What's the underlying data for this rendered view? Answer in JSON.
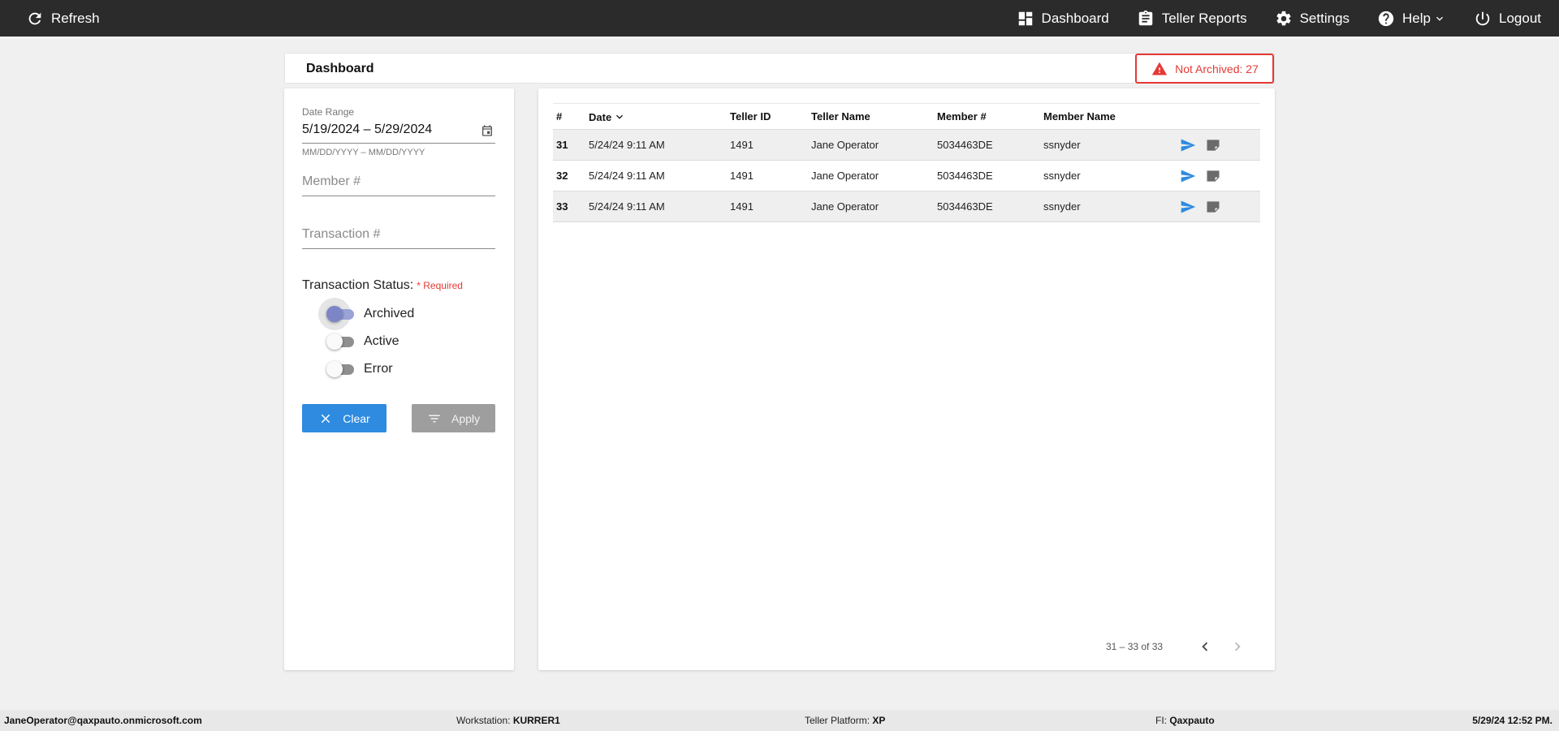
{
  "nav": {
    "refresh": "Refresh",
    "dashboard": "Dashboard",
    "teller_reports": "Teller Reports",
    "settings": "Settings",
    "help": "Help",
    "logout": "Logout"
  },
  "header": {
    "title": "Dashboard",
    "not_archived": "Not Archived: 27"
  },
  "filters": {
    "date_range_label": "Date Range",
    "date_range_value": "5/19/2024 – 5/29/2024",
    "date_hint": "MM/DD/YYYY – MM/DD/YYYY",
    "member_placeholder": "Member #",
    "transaction_placeholder": "Transaction #",
    "status_label": "Transaction Status:",
    "required": "* Required",
    "toggles": [
      {
        "label": "Archived",
        "on": true
      },
      {
        "label": "Active",
        "on": false
      },
      {
        "label": "Error",
        "on": false
      }
    ],
    "clear_label": "Clear",
    "apply_label": "Apply"
  },
  "table": {
    "columns": [
      "#",
      "Date",
      "Teller ID",
      "Teller Name",
      "Member #",
      "Member Name"
    ],
    "rows": [
      {
        "num": "31",
        "date": "5/24/24 9:11 AM",
        "teller_id": "1491",
        "teller_name": "Jane Operator",
        "member_num": "5034463DE",
        "member_name": "ssnyder"
      },
      {
        "num": "32",
        "date": "5/24/24 9:11 AM",
        "teller_id": "1491",
        "teller_name": "Jane Operator",
        "member_num": "5034463DE",
        "member_name": "ssnyder"
      },
      {
        "num": "33",
        "date": "5/24/24 9:11 AM",
        "teller_id": "1491",
        "teller_name": "Jane Operator",
        "member_num": "5034463DE",
        "member_name": "ssnyder"
      }
    ],
    "pager": "31 – 33 of 33"
  },
  "footer": {
    "user": "JaneOperator@qaxpauto.onmicrosoft.com",
    "workstation_label": "Workstation:",
    "workstation": "KURRER1",
    "platform_label": "Teller Platform:",
    "platform": "XP",
    "fi_label": "FI:",
    "fi": "Qaxpauto",
    "datetime": "5/29/24 12:52 PM."
  },
  "colors": {
    "topbar": "#2b2b2b",
    "accent_blue": "#2e8be0",
    "alert_red": "#e53935",
    "toggle_on": "#7c86c6"
  },
  "icons": [
    "refresh-icon",
    "dashboard-icon",
    "clipboard-icon",
    "gear-icon",
    "help-icon",
    "chevron-down-icon",
    "power-icon",
    "warning-icon",
    "calendar-icon",
    "close-icon",
    "filter-icon",
    "send-icon",
    "note-icon",
    "chevron-left-icon",
    "chevron-right-icon"
  ]
}
